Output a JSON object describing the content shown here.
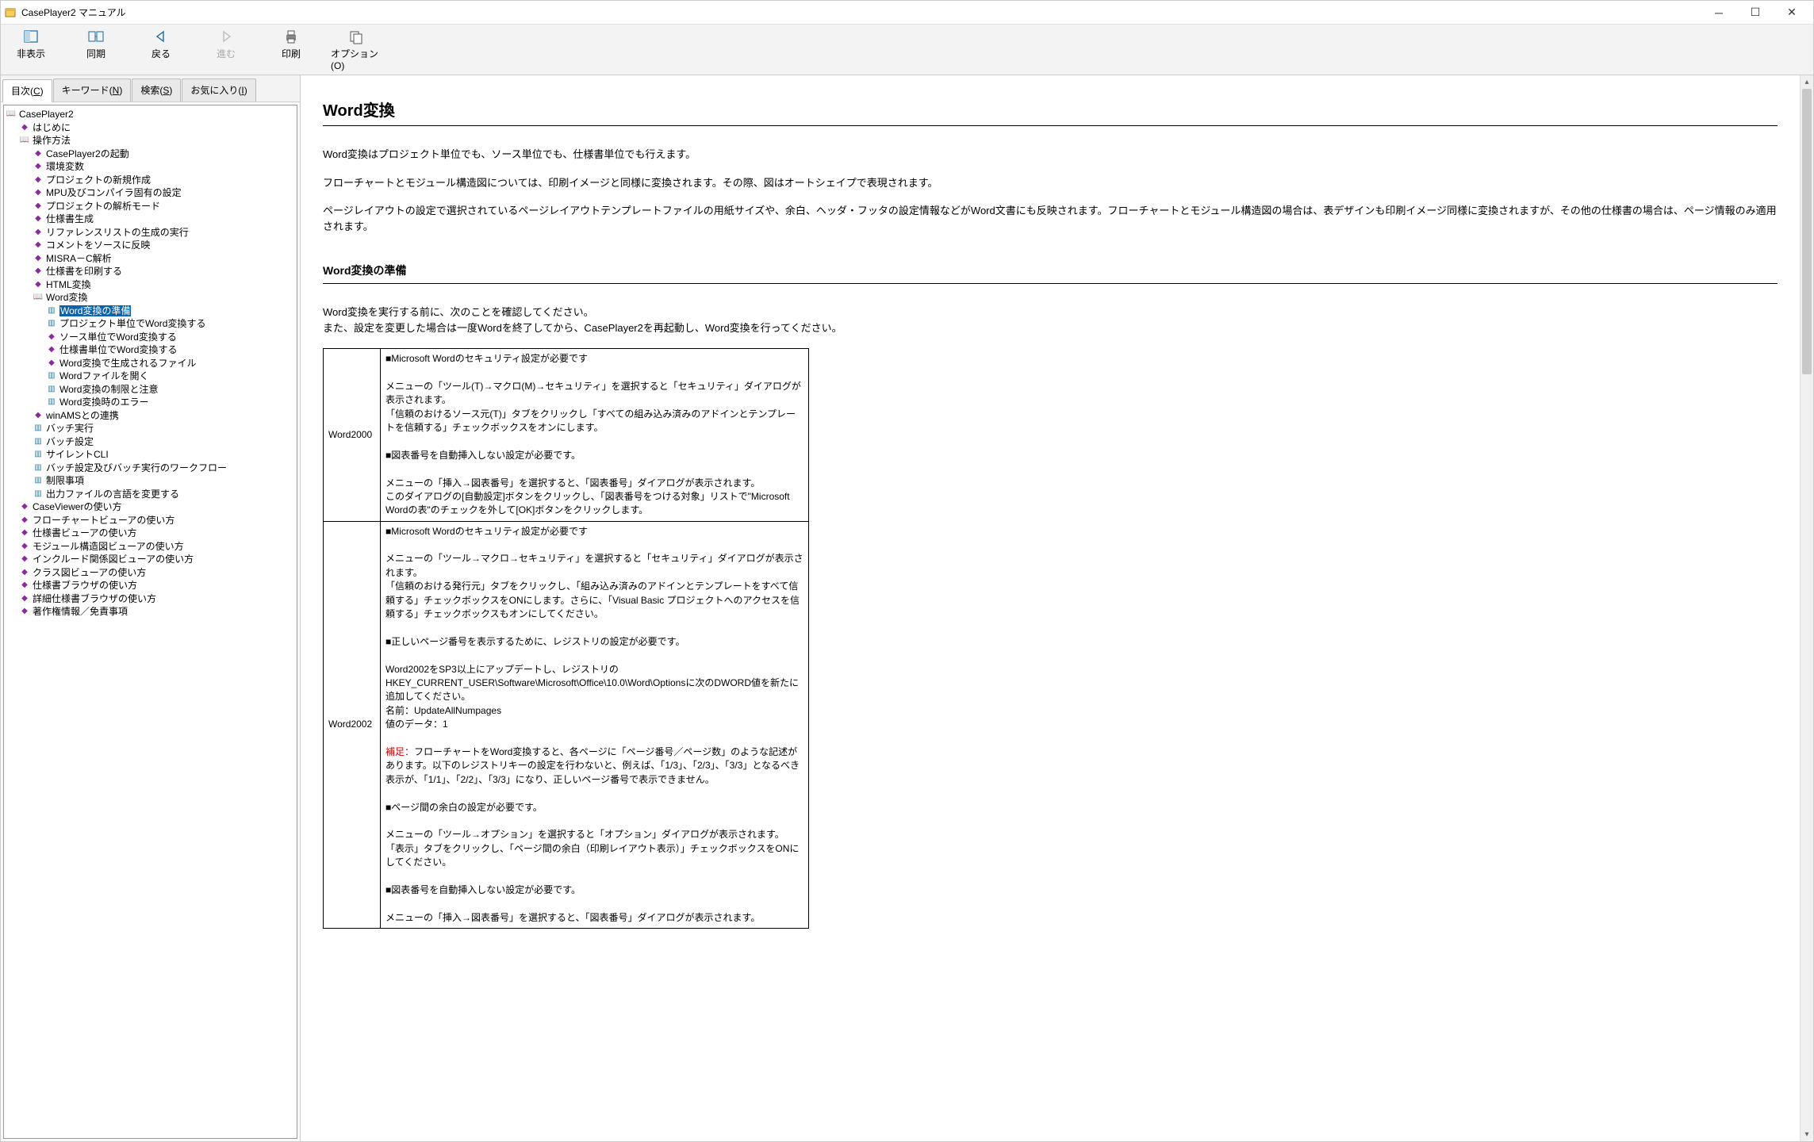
{
  "window": {
    "title": "CasePlayer2 マニュアル"
  },
  "toolbar": {
    "items": [
      {
        "label": "非表示",
        "icon": "hide"
      },
      {
        "label": "同期",
        "icon": "sync"
      },
      {
        "label": "戻る",
        "icon": "back"
      },
      {
        "label": "進む",
        "icon": "forward",
        "disabled": true
      },
      {
        "label": "印刷",
        "icon": "print"
      },
      {
        "label": "オプション(O)",
        "icon": "options"
      }
    ]
  },
  "tabs": {
    "items": [
      {
        "label": "目次(C)",
        "active": true
      },
      {
        "label": "キーワード(N)"
      },
      {
        "label": "検索(S)"
      },
      {
        "label": "お気に入り(I)"
      }
    ]
  },
  "tree": {
    "root": "CasePlayer2",
    "n01": "はじめに",
    "n02": "操作方法",
    "n02a": "CasePlayer2の起動",
    "n02b": "環境変数",
    "n02c": "プロジェクトの新規作成",
    "n02d": "MPU及びコンパイラ固有の設定",
    "n02e": "プロジェクトの解析モード",
    "n02f": "仕様書生成",
    "n02g": "リファレンスリストの生成の実行",
    "n02h": "コメントをソースに反映",
    "n02i": "MISRA－C解析",
    "n02j": "仕様書を印刷する",
    "n02k": "HTML変換",
    "n02l": "Word変換",
    "n02l1": "Word変換の準備",
    "n02l2": "プロジェクト単位でWord変換する",
    "n02l3": "ソース単位でWord変換する",
    "n02l4": "仕様書単位でWord変換する",
    "n02l5": "Word変換で生成されるファイル",
    "n02l6": "Wordファイルを開く",
    "n02l7": "Word変換の制限と注意",
    "n02l8": "Word変換時のエラー",
    "n02m": "winAMSとの連携",
    "n02n": "バッチ実行",
    "n02o": "バッチ設定",
    "n02p": "サイレントCLI",
    "n02q": "バッチ設定及びバッチ実行のワークフロー",
    "n02r": "制限事項",
    "n02s": "出力ファイルの言語を変更する",
    "n03": "CaseViewerの使い方",
    "n04": "フローチャートビューアの使い方",
    "n05": "仕様書ビューアの使い方",
    "n06": "モジュール構造図ビューアの使い方",
    "n07": "インクルード関係図ビューアの使い方",
    "n08": "クラス図ビューアの使い方",
    "n09": "仕様書ブラウザの使い方",
    "n10": "詳細仕様書ブラウザの使い方",
    "n11": "著作権情報／免責事項"
  },
  "content": {
    "h1": "Word変換",
    "p1": "Word変換はプロジェクト単位でも、ソース単位でも、仕様書単位でも行えます。",
    "p2": "フローチャートとモジュール構造図については、印刷イメージと同様に変換されます。その際、図はオートシェイプで表現されます。",
    "p3": "ページレイアウトの設定で選択されているページレイアウトテンプレートファイルの用紙サイズや、余白、ヘッダ・フッタの設定情報などがWord文書にも反映されます。フローチャートとモジュール構造図の場合は、表デザインも印刷イメージ同様に変換されますが、その他の仕様書の場合は、ページ情報のみ適用されます。",
    "h2": "Word変換の準備",
    "p4": "Word変換を実行する前に、次のことを確認してください。",
    "p5": "また、設定を変更した場合は一度Wordを終了してから、CasePlayer2を再起動し、Word変換を行ってください。",
    "table": {
      "r1": {
        "k": "Word2000",
        "b1": "■Microsoft Wordのセキュリティ設定が必要です",
        "b2": "メニューの「ツール(T)→マクロ(M)→セキュリティ」を選択すると「セキュリティ」ダイアログが表示されます。",
        "b3": "「信頼のおけるソース元(T)」タブをクリックし「すべての組み込み済みのアドインとテンプレートを信頼する」チェックボックスをオンにします。",
        "b4": "■図表番号を自動挿入しない設定が必要です。",
        "b5": "メニューの「挿入→図表番号」を選択すると、「図表番号」ダイアログが表示されます。",
        "b6": "このダイアログの[自動設定]ボタンをクリックし、「図表番号をつける対象」リストで\"Microsoft Wordの表\"のチェックを外して[OK]ボタンをクリックします。"
      },
      "r2": {
        "k": "Word2002",
        "b1": "■Microsoft Wordのセキュリティ設定が必要です",
        "b2": "メニューの「ツール→マクロ→セキュリティ」を選択すると「セキュリティ」ダイアログが表示されます。",
        "b3": "「信頼のおける発行元」タブをクリックし、「組み込み済みのアドインとテンプレートをすべて信頼する」チェックボックスをONにします。さらに、「Visual Basic プロジェクトへのアクセスを信頼する」チェックボックスもオンにしてください。",
        "b4": "■正しいページ番号を表示するために、レジストリの設定が必要です。",
        "b5": "Word2002をSP3以上にアップデートし、レジストリのHKEY_CURRENT_USER\\Software\\Microsoft\\Office\\10.0\\Word\\Optionsに次のDWORD値を新たに追加してください。",
        "b6": "名前：UpdateAllNumpages",
        "b7": "値のデータ：1",
        "b8a": "補足：",
        "b8": "フローチャートをWord変換すると、各ページに「ページ番号／ページ数」のような記述があります。以下のレジストリキーの設定を行わないと、例えば、「1/3」、「2/3」、「3/3」となるべき表示が、「1/1」、「2/2」、「3/3」になり、正しいページ番号で表示できません。",
        "b9": "■ページ間の余白の設定が必要です。",
        "b10": "メニューの「ツール→オプション」を選択すると「オプション」ダイアログが表示されます。",
        "b11": "「表示」タブをクリックし、「ページ間の余白（印刷レイアウト表示）」チェックボックスをONにしてください。",
        "b12": "■図表番号を自動挿入しない設定が必要です。",
        "b13": "メニューの「挿入→図表番号」を選択すると、「図表番号」ダイアログが表示されます。"
      }
    }
  }
}
